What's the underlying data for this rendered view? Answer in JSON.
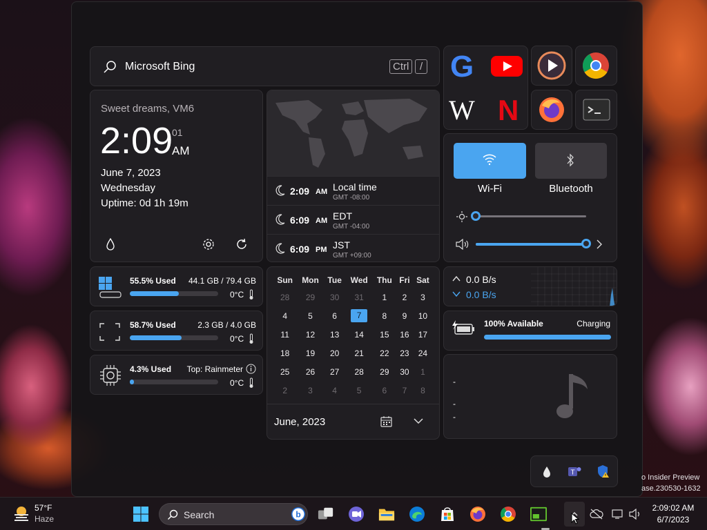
{
  "search": {
    "text": "Microsoft Bing",
    "shortcut_key1": "Ctrl",
    "shortcut_key2": "/"
  },
  "clock": {
    "greeting": "Sweet dreams, VM6",
    "time": "2:09",
    "seconds": "01",
    "ampm": "AM",
    "date": "June 7, 2023",
    "weekday": "Wednesday",
    "uptime": "Uptime: 0d 1h 19m"
  },
  "world_clocks": [
    {
      "time": "2:09",
      "ampm": "AM",
      "label": "Local time",
      "offset": "GMT -08:00"
    },
    {
      "time": "6:09",
      "ampm": "AM",
      "label": "EDT",
      "offset": "GMT -04:00"
    },
    {
      "time": "6:09",
      "ampm": "PM",
      "label": "JST",
      "offset": "GMT +09:00"
    }
  ],
  "apps": [
    {
      "name": "google-icon",
      "letter": "G",
      "color": "#4285f4"
    },
    {
      "name": "youtube-icon",
      "color": "#ff0000"
    },
    {
      "name": "wikipedia-icon",
      "letter": "W",
      "color": "#ffffff"
    },
    {
      "name": "netflix-icon",
      "letter": "N",
      "color": "#e50914"
    },
    {
      "name": "media-player-icon",
      "color": "#f0a050"
    },
    {
      "name": "chrome-icon",
      "color": "#34a853"
    },
    {
      "name": "firefox-icon",
      "color": "#ff7139"
    },
    {
      "name": "terminal-icon",
      "color": "#cccccc"
    }
  ],
  "quick_settings": {
    "wifi_label": "Wi-Fi",
    "bluetooth_label": "Bluetooth",
    "brightness": 0,
    "volume": 100,
    "accent": "#4aa5f0"
  },
  "disk": {
    "used": "55.5% Used",
    "detail": "44.1 GB / 79.4 GB",
    "temp": "0°C",
    "percent": 55.5
  },
  "ram": {
    "used": "58.7% Used",
    "detail": "2.3 GB / 4.0 GB",
    "temp": "0°C",
    "percent": 58.7
  },
  "cpu": {
    "used": "4.3% Used",
    "detail": "Top: Rainmeter",
    "temp": "0°C",
    "percent": 4.3
  },
  "calendar": {
    "days": [
      "Sun",
      "Mon",
      "Tue",
      "Wed",
      "Thu",
      "Fri",
      "Sat"
    ],
    "weeks": [
      [
        "28",
        "29",
        "30",
        "31",
        "1",
        "2",
        "3"
      ],
      [
        "4",
        "5",
        "6",
        "7",
        "8",
        "9",
        "10"
      ],
      [
        "11",
        "12",
        "13",
        "14",
        "15",
        "16",
        "17"
      ],
      [
        "18",
        "19",
        "20",
        "21",
        "22",
        "23",
        "24"
      ],
      [
        "25",
        "26",
        "27",
        "28",
        "29",
        "30",
        "1"
      ],
      [
        "2",
        "3",
        "4",
        "5",
        "6",
        "7",
        "8"
      ]
    ],
    "selected": "7",
    "month_label": "June, 2023"
  },
  "network": {
    "upload": "0.0 B/s",
    "download": "0.0 B/s"
  },
  "battery": {
    "status": "100% Available",
    "state": "Charging",
    "percent": 100
  },
  "media": {
    "line1": "-",
    "line2": "-",
    "line3": "-"
  },
  "desktop_watermark": {
    "line1": "o Insider Preview",
    "line2": "ase.230530-1632"
  },
  "taskbar": {
    "weather_temp": "57°F",
    "weather_desc": "Haze",
    "search_label": "Search",
    "time": "2:09:02 AM",
    "date": "6/7/2023"
  }
}
